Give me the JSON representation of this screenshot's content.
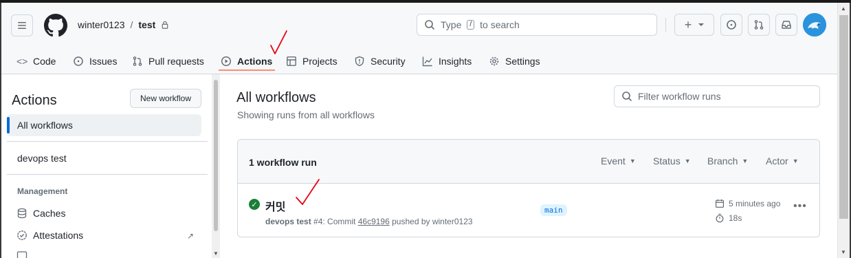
{
  "header": {
    "owner": "winter0123",
    "separator": "/",
    "repo": "test",
    "search_prefix": "Type",
    "search_key": "/",
    "search_suffix": "to search"
  },
  "tabs": [
    {
      "label": "Code",
      "icon": "code-icon"
    },
    {
      "label": "Issues",
      "icon": "issue-icon"
    },
    {
      "label": "Pull requests",
      "icon": "pull-request-icon"
    },
    {
      "label": "Actions",
      "icon": "play-icon",
      "selected": true
    },
    {
      "label": "Projects",
      "icon": "table-icon"
    },
    {
      "label": "Security",
      "icon": "shield-icon"
    },
    {
      "label": "Insights",
      "icon": "graph-icon"
    },
    {
      "label": "Settings",
      "icon": "gear-icon"
    }
  ],
  "sidebar": {
    "title": "Actions",
    "new_workflow": "New workflow",
    "all_workflows": "All workflows",
    "workflow": "devops test",
    "section": "Management",
    "caches": "Caches",
    "attestations": "Attestations"
  },
  "main": {
    "title": "All workflows",
    "subtitle": "Showing runs from all workflows",
    "filter_placeholder": "Filter workflow runs",
    "runs_count": "1 workflow run",
    "filters": [
      "Event",
      "Status",
      "Branch",
      "Actor"
    ],
    "run": {
      "title": "커밋",
      "workflow": "devops test",
      "number": "#4",
      "commit_label": ": Commit",
      "sha": "46c9196",
      "pushed_by": "pushed by winter0123",
      "branch": "main",
      "when": "5 minutes ago",
      "duration": "18s",
      "status": "success"
    }
  },
  "colors": {
    "accent": "#0969da",
    "tab_underline": "#fd8c73",
    "success": "#1a7f37",
    "annotation": "#e8000b"
  }
}
